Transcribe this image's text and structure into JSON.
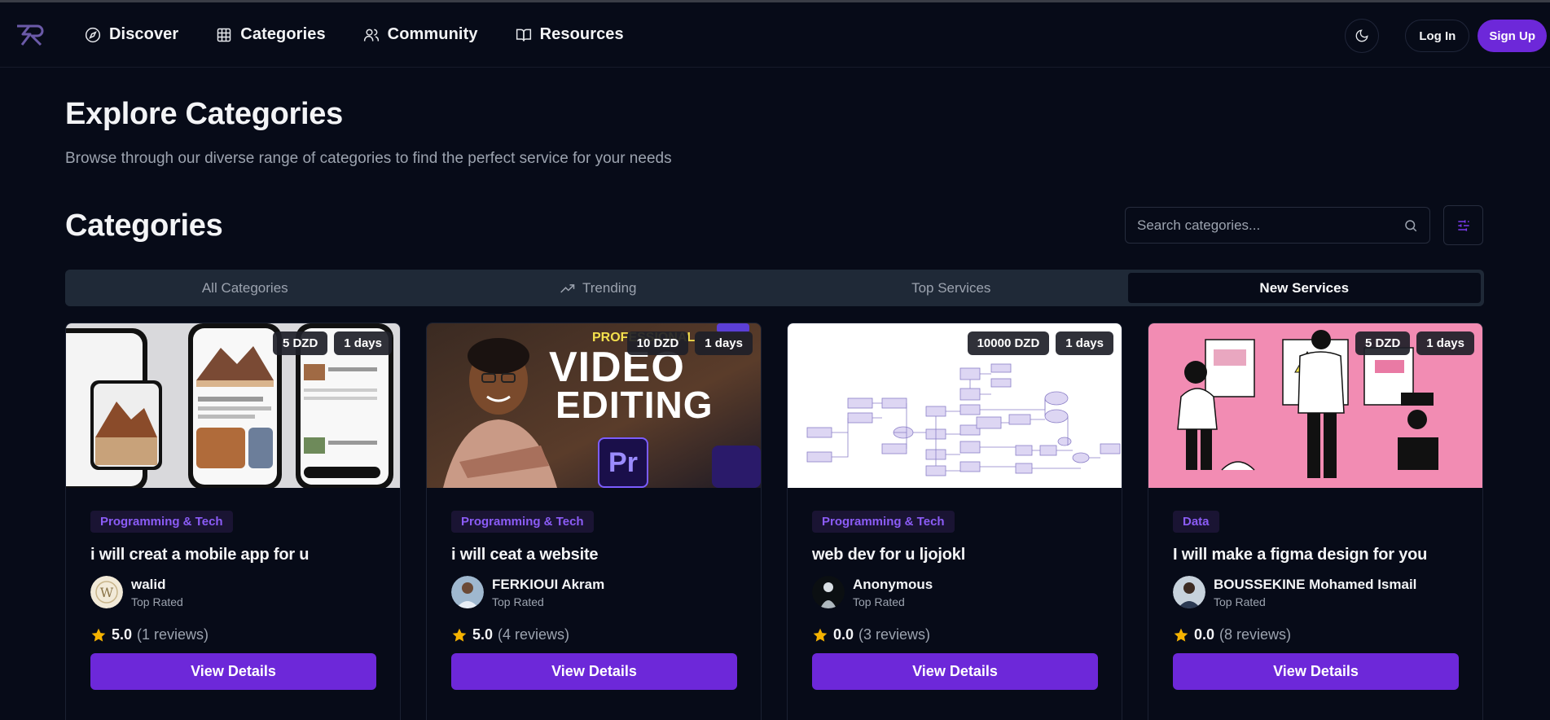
{
  "nav": {
    "links": [
      {
        "label": "Discover",
        "icon": "compass-icon"
      },
      {
        "label": "Categories",
        "icon": "grid-icon"
      },
      {
        "label": "Community",
        "icon": "users-icon"
      },
      {
        "label": "Resources",
        "icon": "book-icon"
      }
    ],
    "theme_icon": "moon-icon",
    "login_label": "Log In",
    "signup_label": "Sign Up"
  },
  "hero": {
    "title": "Explore Categories",
    "subtitle": "Browse through our diverse range of categories to find the perfect service for your needs"
  },
  "section": {
    "title": "Categories",
    "search_placeholder": "Search categories...",
    "filter_icon": "sliders-icon"
  },
  "tabs": [
    {
      "label": "All Categories"
    },
    {
      "label": "Trending",
      "icon": "trending-up-icon"
    },
    {
      "label": "Top Services"
    },
    {
      "label": "New Services",
      "active": true
    }
  ],
  "cards": [
    {
      "price": "5 DZD",
      "days": "1 days",
      "category": "Programming & Tech",
      "title": "i will creat a mobile app for u",
      "author": "walid",
      "role": "Top Rated",
      "rating": "5.0",
      "reviews": "(1 reviews)",
      "button": "View Details",
      "thumb": "mobile-app-screens"
    },
    {
      "price": "10 DZD",
      "days": "1 days",
      "category": "Programming & Tech",
      "title": "i will ceat a website",
      "author": "FERKIOUI Akram",
      "role": "Top Rated",
      "rating": "5.0",
      "reviews": "(4 reviews)",
      "button": "View Details",
      "thumb": "video-editing-banner",
      "thumb_text": {
        "top": "PROFESSIONAL",
        "line1": "VIDEO",
        "line2": "EDITING",
        "logo": "Pr"
      }
    },
    {
      "price": "10000 DZD",
      "days": "1 days",
      "category": "Programming & Tech",
      "title": "web dev for u ljojokl",
      "author": "Anonymous",
      "role": "Top Rated",
      "rating": "0.0",
      "reviews": "(3 reviews)",
      "button": "View Details",
      "thumb": "flowchart-diagram"
    },
    {
      "price": "5 DZD",
      "days": "1 days",
      "category": "Data",
      "title": "I will make a figma design for you",
      "author": "BOUSSEKINE Mohamed Ismail",
      "role": "Top Rated",
      "rating": "0.0",
      "reviews": "(8 reviews)",
      "button": "View Details",
      "thumb": "pink-illustration"
    }
  ],
  "colors": {
    "background": "#070b18",
    "accent": "#6d28d9",
    "star": "#f5b301",
    "tag_text": "#8b5cf6"
  }
}
